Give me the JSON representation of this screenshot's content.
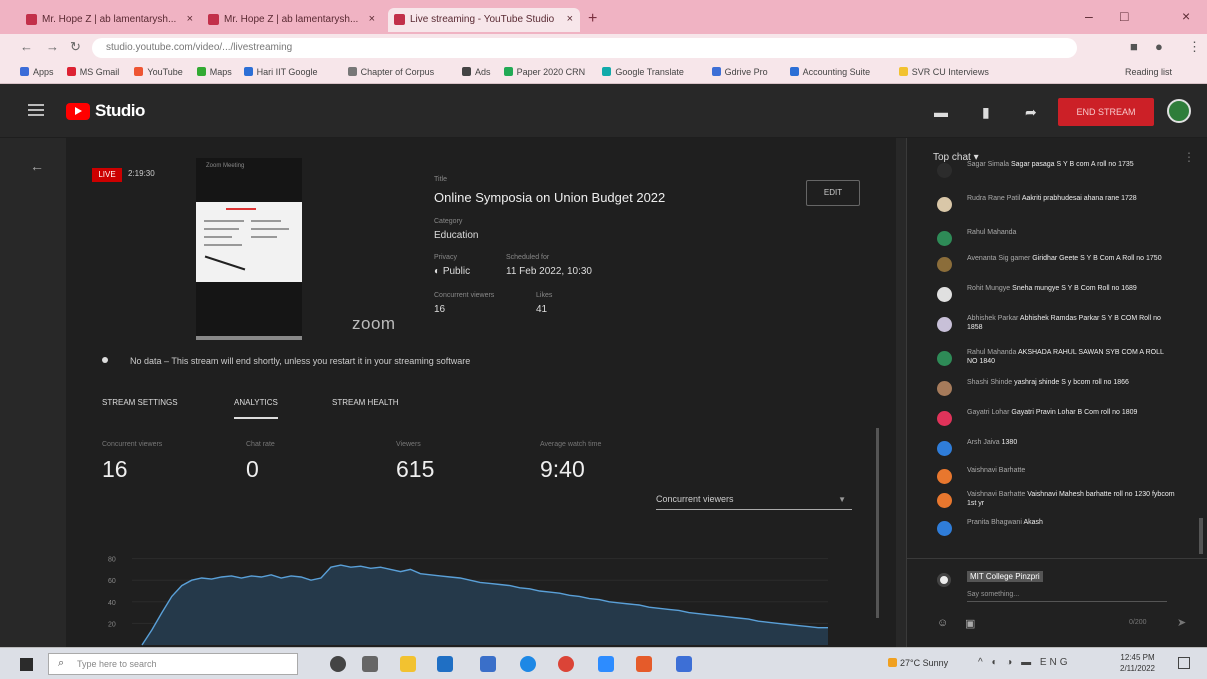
{
  "browser": {
    "tabs": [
      {
        "label": "Mr. Hope Z | ab lamentarysh..."
      },
      {
        "label": "Mr. Hope Z | ab lamentarysh..."
      },
      {
        "label": "Live streaming - YouTube Studio"
      }
    ],
    "url": "studio.youtube.com/video/.../livestreaming",
    "bookmarks": [
      "Apps",
      "MS Gmail",
      "YouTube",
      "Maps",
      "Hari IIT Google",
      "Chapter of Corpus",
      "Ads",
      "Paper 2020 CRN",
      "Google Translate",
      "Gdrive Pro",
      "Accounting Suite",
      "SVR CU Interviews"
    ],
    "reading_list": "Reading list"
  },
  "studio": {
    "logo_text": "Studio",
    "end_stream_label": "END STREAM"
  },
  "stream": {
    "live_badge": "LIVE",
    "live_time": "2:19:30",
    "preview_header": "Zoom Meeting",
    "zoom_label": "zoom",
    "title_label": "Title",
    "title": "Online Symposia on Union Budget 2022",
    "category_label": "Category",
    "category": "Education",
    "privacy_label": "Privacy",
    "privacy": "Public",
    "scheduled_label": "Scheduled for",
    "scheduled": "11 Feb 2022, 10:30",
    "concurrent_label": "Concurrent viewers",
    "concurrent": "16",
    "likes_label": "Likes",
    "likes": "41",
    "edit_label": "EDIT",
    "nodata_text": "No data – This stream will end shortly, unless you restart it in your streaming software"
  },
  "tabs": [
    {
      "label": "STREAM SETTINGS"
    },
    {
      "label": "ANALYTICS"
    },
    {
      "label": "STREAM HEALTH"
    }
  ],
  "stats": [
    {
      "label": "Concurrent viewers",
      "value": "16"
    },
    {
      "label": "Chat rate",
      "value": "0"
    },
    {
      "label": "Viewers",
      "value": "615"
    },
    {
      "label": "Average watch time",
      "value": "9:40"
    }
  ],
  "dropdown_value": "Concurrent viewers",
  "chart_data": {
    "type": "area",
    "yticks": [
      "80",
      "60",
      "40",
      "20"
    ],
    "ylim": [
      0,
      100
    ],
    "x": [
      0,
      1,
      2,
      3,
      4,
      5,
      6,
      7,
      8,
      9,
      10,
      11,
      12,
      13,
      14,
      15,
      16,
      17,
      18,
      19,
      20,
      21,
      22,
      23,
      24,
      25,
      26,
      27,
      28,
      29,
      30,
      31,
      32,
      33,
      34,
      35,
      36,
      37,
      38,
      39,
      40,
      41,
      42,
      43,
      44,
      45,
      46,
      47,
      48,
      49,
      50,
      51,
      52,
      53,
      54,
      55,
      56,
      57,
      58,
      59,
      60,
      61,
      62,
      63,
      64,
      65,
      66,
      67,
      68,
      69
    ],
    "series": [
      {
        "values": [
          0,
          14,
          30,
          45,
          55,
          60,
          62,
          61,
          63,
          64,
          62,
          64,
          63,
          65,
          62,
          64,
          63,
          60,
          62,
          72,
          74,
          72,
          73,
          71,
          72,
          70,
          68,
          70,
          66,
          65,
          64,
          63,
          62,
          60,
          58,
          57,
          56,
          55,
          53,
          52,
          50,
          49,
          48,
          46,
          45,
          43,
          42,
          40,
          39,
          38,
          37,
          35,
          34,
          33,
          32,
          30,
          29,
          28,
          27,
          26,
          25,
          24,
          22,
          21,
          20,
          19,
          18,
          17,
          16,
          16
        ]
      }
    ]
  },
  "chat": {
    "header": "Top chat",
    "messages": [
      {
        "author": "Sagar Simala",
        "text": "Sagar pasaga S Y B com A roll no 1735",
        "color": "#2c2c2c"
      },
      {
        "author": "Rudra Rane Patil",
        "text": "Aakriti prabhudesai ahana rane 1728",
        "color": "#d9c7a8"
      },
      {
        "author": "Rahul Mahanda",
        "text": "",
        "color": "#2e8b57"
      },
      {
        "author": "Avenanta Sig gamer",
        "text": "Giridhar Geete S Y B Com A Roll no 1750",
        "color": "#8b6d3a"
      },
      {
        "author": "Rohit Mungye",
        "text": "Sneha mungye S Y B Com Roll no 1689",
        "color": "#e0e0e0"
      },
      {
        "author": "Abhishek Parkar",
        "text": "Abhishek Ramdas Parkar S Y B COM Roll no 1858",
        "color": "#c8c0d8"
      },
      {
        "author": "Rahul Mahanda",
        "text": "AKSHADA RAHUL SAWAN SYB COM A ROLL NO 1840",
        "color": "#2e8b57"
      },
      {
        "author": "Shashi Shinde",
        "text": "yashraj shinde S y bcom roll no 1866",
        "color": "#a67b5b"
      },
      {
        "author": "Gayatri Lohar",
        "text": "Gayatri Pravin Lohar B Com roll no 1809",
        "color": "#e0335a"
      },
      {
        "author": "Arsh Jaiva",
        "text": "1380",
        "color": "#2f7dd9"
      },
      {
        "author": "Vaishnavi Barhatte",
        "text": "",
        "color": "#e8772e"
      },
      {
        "author": "Vaishnavi Barhatte",
        "text": "Vaishnavi Mahesh barhatte roll no 1230 fybcom 1st yr",
        "color": "#e8772e"
      },
      {
        "author": "Pranita Bhagwani",
        "text": "Akash",
        "color": "#2f7dd9"
      }
    ],
    "me_name": "MIT College Pinzpri",
    "input_placeholder": "Say something...",
    "char_count": "0/200"
  },
  "taskbar": {
    "search_placeholder": "Type here to search",
    "weather": "27°C Sunny",
    "lang": "ENG",
    "time": "12:45 PM",
    "date": "2/11/2022"
  }
}
